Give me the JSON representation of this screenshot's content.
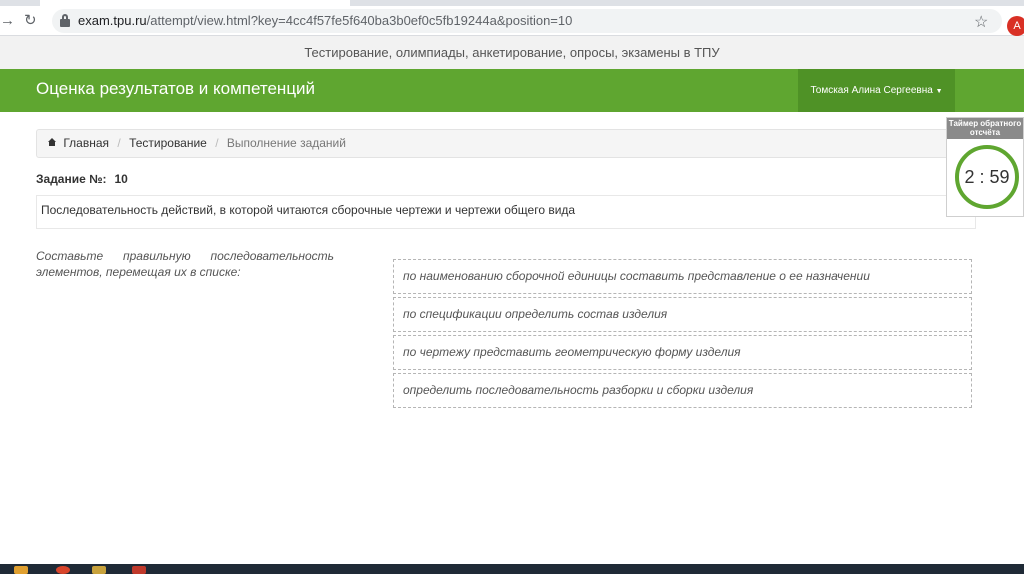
{
  "browser": {
    "url_host": "exam.tpu.ru",
    "url_path": "/attempt/view.html?key=4cc4f57fe5f640ba3b0ef0c5fb19244a&position=10",
    "profile_initial": "A"
  },
  "site": {
    "banner": "Тестирование, олимпиады, анкетирование, опросы, экзамены в ТПУ",
    "brand": "Оценка результатов и компетенций",
    "user_name": "Томская Алина Сергеевна"
  },
  "breadcrumb": {
    "home": "Главная",
    "testing": "Тестирование",
    "current": "Выполнение заданий"
  },
  "task": {
    "label": "Задание №:",
    "number": "10",
    "question": "Последовательность действий, в которой читаются сборочные чертежи и чертежи общего вида",
    "instruction_line1": "Составьте правильную последовательность",
    "instruction_line2": "элементов, перемещая их в списке:",
    "items": [
      "по наименованию сборочной единицы составить представление о ее назначении",
      "по спецификации определить состав изделия",
      "по чертежу представить геометрическую форму изделия",
      "определить последовательность разборки и сборки изделия"
    ]
  },
  "timer": {
    "title": "Таймер обратного отсчёта",
    "value": "2 : 59",
    "accent": "#5fa630"
  },
  "colors": {
    "header_green": "#5fa630",
    "user_menu_green": "#4f9226"
  }
}
